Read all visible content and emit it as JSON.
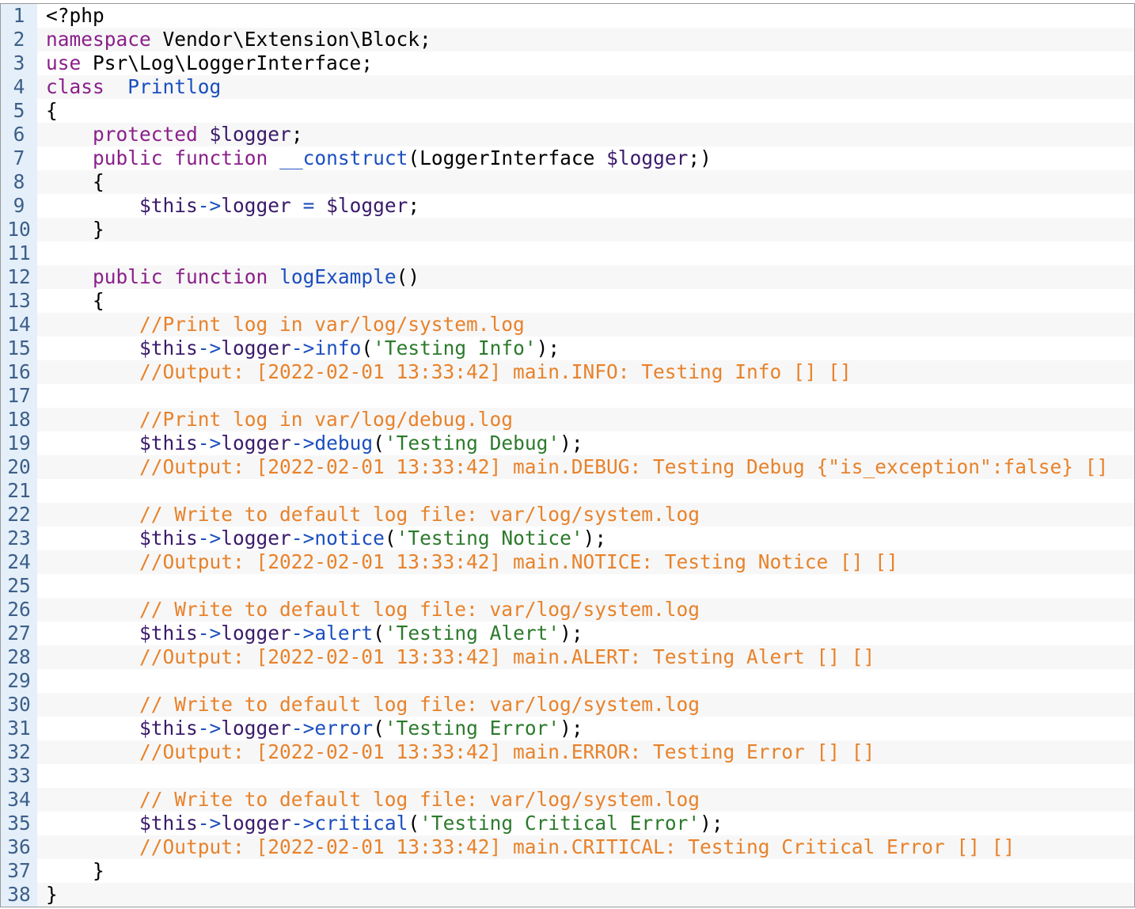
{
  "editor": {
    "language": "php",
    "colors": {
      "gutter_background": "#e4effa",
      "gutter_text": "#3d5f88",
      "alt_row_background": "#f7f7f7",
      "keyword": "#8a208a",
      "class_name": "#1b4fbf",
      "variable": "#3a1a6a",
      "operator": "#1b4fbf",
      "string": "#2c7a2c",
      "comment": "#e8822a",
      "border": "#999999"
    },
    "lines": [
      {
        "n": "1",
        "tokens": [
          [
            "plain",
            "<?php"
          ]
        ]
      },
      {
        "n": "2",
        "tokens": [
          [
            "kw",
            "namespace"
          ],
          [
            "plain",
            " Vendor\\Extension\\Block;"
          ]
        ]
      },
      {
        "n": "3",
        "tokens": [
          [
            "kw",
            "use"
          ],
          [
            "plain",
            " Psr\\Log\\LoggerInterface;"
          ]
        ]
      },
      {
        "n": "4",
        "tokens": [
          [
            "kw",
            "class"
          ],
          [
            "plain",
            "  "
          ],
          [
            "cls",
            "Printlog"
          ]
        ]
      },
      {
        "n": "5",
        "tokens": [
          [
            "plain",
            "{"
          ]
        ]
      },
      {
        "n": "6",
        "tokens": [
          [
            "plain",
            "    "
          ],
          [
            "kw",
            "protected"
          ],
          [
            "plain",
            " "
          ],
          [
            "var",
            "$logger"
          ],
          [
            "plain",
            ";"
          ]
        ]
      },
      {
        "n": "7",
        "tokens": [
          [
            "plain",
            "    "
          ],
          [
            "kw",
            "public"
          ],
          [
            "plain",
            " "
          ],
          [
            "kw",
            "function"
          ],
          [
            "plain",
            " "
          ],
          [
            "cls",
            "__construct"
          ],
          [
            "plain",
            "(LoggerInterface "
          ],
          [
            "var",
            "$logger"
          ],
          [
            "plain",
            ";)"
          ]
        ]
      },
      {
        "n": "8",
        "tokens": [
          [
            "plain",
            "    {"
          ]
        ]
      },
      {
        "n": "9",
        "tokens": [
          [
            "plain",
            "        "
          ],
          [
            "var",
            "$this"
          ],
          [
            "op",
            "->"
          ],
          [
            "var",
            "logger"
          ],
          [
            "plain",
            " "
          ],
          [
            "op",
            "="
          ],
          [
            "plain",
            " "
          ],
          [
            "var",
            "$logger"
          ],
          [
            "plain",
            ";"
          ]
        ]
      },
      {
        "n": "10",
        "tokens": [
          [
            "plain",
            "    }"
          ]
        ]
      },
      {
        "n": "11",
        "tokens": []
      },
      {
        "n": "12",
        "tokens": [
          [
            "plain",
            "    "
          ],
          [
            "kw",
            "public"
          ],
          [
            "plain",
            " "
          ],
          [
            "kw",
            "function"
          ],
          [
            "plain",
            " "
          ],
          [
            "cls",
            "logExample"
          ],
          [
            "plain",
            "()"
          ]
        ]
      },
      {
        "n": "13",
        "tokens": [
          [
            "plain",
            "    {"
          ]
        ]
      },
      {
        "n": "14",
        "tokens": [
          [
            "plain",
            "        "
          ],
          [
            "cmt",
            "//Print log in var/log/system.log"
          ]
        ]
      },
      {
        "n": "15",
        "tokens": [
          [
            "plain",
            "        "
          ],
          [
            "var",
            "$this"
          ],
          [
            "op",
            "->"
          ],
          [
            "var",
            "logger"
          ],
          [
            "op",
            "->"
          ],
          [
            "cls",
            "info"
          ],
          [
            "plain",
            "("
          ],
          [
            "str",
            "'Testing Info'"
          ],
          [
            "plain",
            ");"
          ]
        ]
      },
      {
        "n": "16",
        "tokens": [
          [
            "plain",
            "        "
          ],
          [
            "cmt",
            "//Output: [2022-02-01 13:33:42] main.INFO: Testing Info [] []"
          ]
        ]
      },
      {
        "n": "17",
        "tokens": []
      },
      {
        "n": "18",
        "tokens": [
          [
            "plain",
            "        "
          ],
          [
            "cmt",
            "//Print log in var/log/debug.log"
          ]
        ]
      },
      {
        "n": "19",
        "tokens": [
          [
            "plain",
            "        "
          ],
          [
            "var",
            "$this"
          ],
          [
            "op",
            "->"
          ],
          [
            "var",
            "logger"
          ],
          [
            "op",
            "->"
          ],
          [
            "cls",
            "debug"
          ],
          [
            "plain",
            "("
          ],
          [
            "str",
            "'Testing Debug'"
          ],
          [
            "plain",
            ");"
          ]
        ]
      },
      {
        "n": "20",
        "tokens": [
          [
            "plain",
            "        "
          ],
          [
            "cmt",
            "//Output: [2022-02-01 13:33:42] main.DEBUG: Testing Debug {\"is_exception\":false} []"
          ]
        ]
      },
      {
        "n": "21",
        "tokens": []
      },
      {
        "n": "22",
        "tokens": [
          [
            "plain",
            "        "
          ],
          [
            "cmt",
            "// Write to default log file: var/log/system.log"
          ]
        ]
      },
      {
        "n": "23",
        "tokens": [
          [
            "plain",
            "        "
          ],
          [
            "var",
            "$this"
          ],
          [
            "op",
            "->"
          ],
          [
            "var",
            "logger"
          ],
          [
            "op",
            "->"
          ],
          [
            "cls",
            "notice"
          ],
          [
            "plain",
            "("
          ],
          [
            "str",
            "'Testing Notice'"
          ],
          [
            "plain",
            ");"
          ]
        ]
      },
      {
        "n": "24",
        "tokens": [
          [
            "plain",
            "        "
          ],
          [
            "cmt",
            "//Output: [2022-02-01 13:33:42] main.NOTICE: Testing Notice [] []"
          ]
        ]
      },
      {
        "n": "25",
        "tokens": []
      },
      {
        "n": "26",
        "tokens": [
          [
            "plain",
            "        "
          ],
          [
            "cmt",
            "// Write to default log file: var/log/system.log"
          ]
        ]
      },
      {
        "n": "27",
        "tokens": [
          [
            "plain",
            "        "
          ],
          [
            "var",
            "$this"
          ],
          [
            "op",
            "->"
          ],
          [
            "var",
            "logger"
          ],
          [
            "op",
            "->"
          ],
          [
            "cls",
            "alert"
          ],
          [
            "plain",
            "("
          ],
          [
            "str",
            "'Testing Alert'"
          ],
          [
            "plain",
            ");"
          ]
        ]
      },
      {
        "n": "28",
        "tokens": [
          [
            "plain",
            "        "
          ],
          [
            "cmt",
            "//Output: [2022-02-01 13:33:42] main.ALERT: Testing Alert [] []"
          ]
        ]
      },
      {
        "n": "29",
        "tokens": []
      },
      {
        "n": "30",
        "tokens": [
          [
            "plain",
            "        "
          ],
          [
            "cmt",
            "// Write to default log file: var/log/system.log"
          ]
        ]
      },
      {
        "n": "31",
        "tokens": [
          [
            "plain",
            "        "
          ],
          [
            "var",
            "$this"
          ],
          [
            "op",
            "->"
          ],
          [
            "var",
            "logger"
          ],
          [
            "op",
            "->"
          ],
          [
            "cls",
            "error"
          ],
          [
            "plain",
            "("
          ],
          [
            "str",
            "'Testing Error'"
          ],
          [
            "plain",
            ");"
          ]
        ]
      },
      {
        "n": "32",
        "tokens": [
          [
            "plain",
            "        "
          ],
          [
            "cmt",
            "//Output: [2022-02-01 13:33:42] main.ERROR: Testing Error [] []"
          ]
        ]
      },
      {
        "n": "33",
        "tokens": []
      },
      {
        "n": "34",
        "tokens": [
          [
            "plain",
            "        "
          ],
          [
            "cmt",
            "// Write to default log file: var/log/system.log"
          ]
        ]
      },
      {
        "n": "35",
        "tokens": [
          [
            "plain",
            "        "
          ],
          [
            "var",
            "$this"
          ],
          [
            "op",
            "->"
          ],
          [
            "var",
            "logger"
          ],
          [
            "op",
            "->"
          ],
          [
            "cls",
            "critical"
          ],
          [
            "plain",
            "("
          ],
          [
            "str",
            "'Testing Critical Error'"
          ],
          [
            "plain",
            ");"
          ]
        ]
      },
      {
        "n": "36",
        "tokens": [
          [
            "plain",
            "        "
          ],
          [
            "cmt",
            "//Output: [2022-02-01 13:33:42] main.CRITICAL: Testing Critical Error [] []"
          ]
        ]
      },
      {
        "n": "37",
        "tokens": [
          [
            "plain",
            "    }"
          ]
        ]
      },
      {
        "n": "38",
        "tokens": [
          [
            "plain",
            "}"
          ]
        ]
      }
    ]
  }
}
